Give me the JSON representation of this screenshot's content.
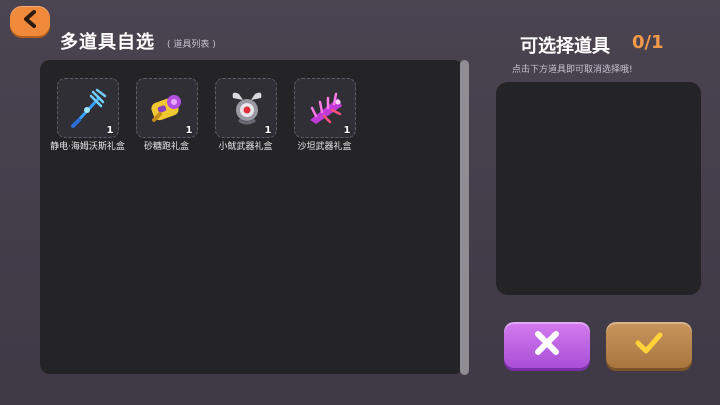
{
  "header": {
    "title": "多道具自选",
    "subtitle": "( 道具列表 )",
    "back_icon": "chevron-left-icon"
  },
  "items": [
    {
      "name": "静电·海姆沃斯礼盒",
      "count": "1",
      "icon": "trident-icon"
    },
    {
      "name": "砂糖跑礼盒",
      "count": "1",
      "icon": "candy-gun-icon"
    },
    {
      "name": "小鱿武器礼盒",
      "count": "1",
      "icon": "squid-weapon-icon"
    },
    {
      "name": "沙坦武器礼盒",
      "count": "1",
      "icon": "spiked-blade-icon"
    }
  ],
  "selection": {
    "title": "可选择道具",
    "count": "0/1",
    "hint": "点击下方道具即可取消选择哦!"
  },
  "buttons": {
    "cancel_icon": "x-icon",
    "confirm_icon": "check-icon"
  },
  "colors": {
    "accent_orange": "#f08a3a",
    "count_orange": "#f29a4c",
    "cancel_purple": "#b65ee0",
    "confirm_gold": "#b98450"
  }
}
